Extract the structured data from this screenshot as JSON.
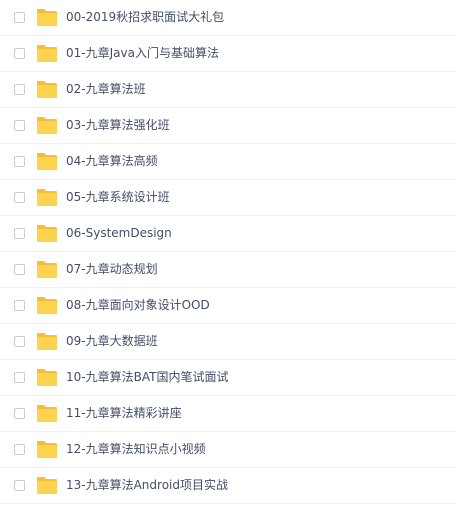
{
  "files": [
    {
      "name": "00-2019秋招求职面试大礼包",
      "type": "folder-icon"
    },
    {
      "name": "01-九章Java入门与基础算法",
      "type": "folder-icon"
    },
    {
      "name": "02-九章算法班",
      "type": "folder-icon"
    },
    {
      "name": "03-九章算法强化班",
      "type": "folder-icon"
    },
    {
      "name": "04-九章算法高频",
      "type": "folder-icon"
    },
    {
      "name": "05-九章系统设计班",
      "type": "folder-icon"
    },
    {
      "name": "06-SystemDesign",
      "type": "folder-icon"
    },
    {
      "name": "07-九章动态规划",
      "type": "folder-icon"
    },
    {
      "name": "08-九章面向对象设计OOD",
      "type": "folder-icon"
    },
    {
      "name": "09-九章大数据班",
      "type": "folder-icon"
    },
    {
      "name": "10-九章算法BAT国内笔试面试",
      "type": "folder-icon"
    },
    {
      "name": "11-九章算法精彩讲座",
      "type": "folder-icon"
    },
    {
      "name": "12-九章算法知识点小视频",
      "type": "folder-icon"
    },
    {
      "name": "13-九章算法Android项目实战",
      "type": "folder-icon"
    }
  ],
  "colors": {
    "folder_back": "#f5bd3a",
    "folder_front": "#fdd24f",
    "text": "#424e67",
    "divider": "#eef0f4",
    "checkbox_border": "#c9ccd3"
  }
}
